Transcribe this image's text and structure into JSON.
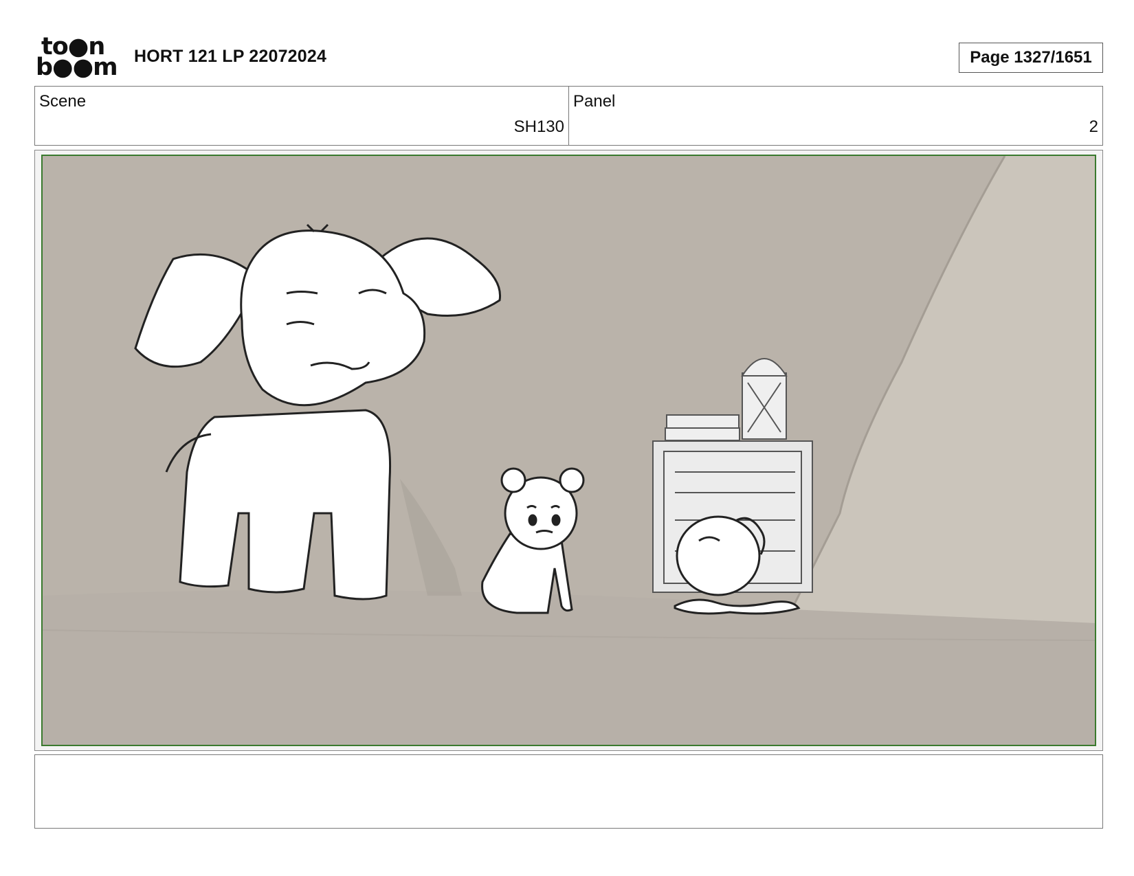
{
  "header": {
    "logo_line1": "to●n",
    "logo_line2": "b●●m",
    "title": "HORT 121 LP 22072024",
    "page_label": "Page 1327/1651"
  },
  "info": {
    "scene_label": "Scene",
    "scene_value": "SH130",
    "panel_label": "Panel",
    "panel_value": "2"
  },
  "colors": {
    "frame_border": "#3a7a2e",
    "background": "#bab3aa"
  },
  "notes": {
    "text": ""
  }
}
